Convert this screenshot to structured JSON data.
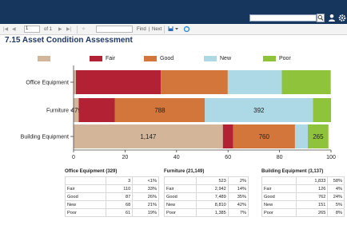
{
  "toolbar": {
    "first": "|◀",
    "prev": "◀",
    "page_value": "1",
    "of_label": "of 1",
    "next": "▶",
    "last": "▶|",
    "refresh": "✧",
    "find_label": "Find",
    "find_sep": "|",
    "next_label": "Next",
    "export_icon": "export-icon",
    "refresh_icon": "refresh-icon"
  },
  "header": {
    "search_value": "",
    "icons": [
      "search-icon",
      "user-icon",
      "gear-icon"
    ]
  },
  "page": {
    "title": "7.15 Asset Condition Assessment"
  },
  "colors": {
    "blank": "#d3b69a",
    "fair": "#b22234",
    "good": "#d2763b",
    "new": "#add8e6",
    "poor": "#8fc33c",
    "topbar": "#17365d"
  },
  "legend": [
    {
      "label": "",
      "color_key": "blank"
    },
    {
      "label": "Fair",
      "color_key": "fair"
    },
    {
      "label": "Good",
      "color_key": "good"
    },
    {
      "label": "New",
      "color_key": "new"
    },
    {
      "label": "Poor",
      "color_key": "poor"
    }
  ],
  "chart_data": {
    "type": "bar",
    "orientation": "horizontal",
    "stacked": true,
    "percent": true,
    "categories": [
      "Office Equipment",
      "Furniture",
      "Building Equipment"
    ],
    "series": [
      {
        "name": "",
        "color_key": "blank",
        "values": [
          0.9,
          2,
          58
        ],
        "labels": [
          "",
          "479",
          "1,147"
        ]
      },
      {
        "name": "Fair",
        "color_key": "fair",
        "values": [
          33,
          14,
          4
        ],
        "labels": [
          "",
          "",
          ""
        ]
      },
      {
        "name": "Good",
        "color_key": "good",
        "values": [
          26,
          35,
          24
        ],
        "labels": [
          "",
          "788",
          "760"
        ]
      },
      {
        "name": "New",
        "color_key": "new",
        "values": [
          21,
          42,
          5
        ],
        "labels": [
          "",
          "392",
          ""
        ]
      },
      {
        "name": "Poor",
        "color_key": "poor",
        "values": [
          19,
          7,
          8
        ],
        "labels": [
          "",
          "",
          "265"
        ]
      }
    ],
    "xlim": [
      0,
      100
    ],
    "xticks": [
      "0",
      "20",
      "40",
      "60",
      "80",
      "100"
    ],
    "legend_position": "top"
  },
  "tables": [
    {
      "title": "Office Equipment  (329)",
      "rows": [
        {
          "label": "",
          "count": "3",
          "pct": "<1%"
        },
        {
          "label": "Fair",
          "count": "110",
          "pct": "33%"
        },
        {
          "label": "Good",
          "count": "87",
          "pct": "26%"
        },
        {
          "label": "New",
          "count": "68",
          "pct": "21%"
        },
        {
          "label": "Poor",
          "count": "61",
          "pct": "19%"
        }
      ]
    },
    {
      "title": "Furniture  (21,149)",
      "rows": [
        {
          "label": "",
          "count": "523",
          "pct": "2%"
        },
        {
          "label": "Fair",
          "count": "2,942",
          "pct": "14%"
        },
        {
          "label": "Good",
          "count": "7,489",
          "pct": "35%"
        },
        {
          "label": "New",
          "count": "8,810",
          "pct": "42%"
        },
        {
          "label": "Poor",
          "count": "1,385",
          "pct": "7%"
        }
      ]
    },
    {
      "title": "Building Equipment  (3,137)",
      "rows": [
        {
          "label": "",
          "count": "1,833",
          "pct": "58%"
        },
        {
          "label": "Fair",
          "count": "126",
          "pct": "4%"
        },
        {
          "label": "Good",
          "count": "762",
          "pct": "24%"
        },
        {
          "label": "New",
          "count": "151",
          "pct": "5%"
        },
        {
          "label": "Poor",
          "count": "265",
          "pct": "8%"
        }
      ]
    }
  ]
}
